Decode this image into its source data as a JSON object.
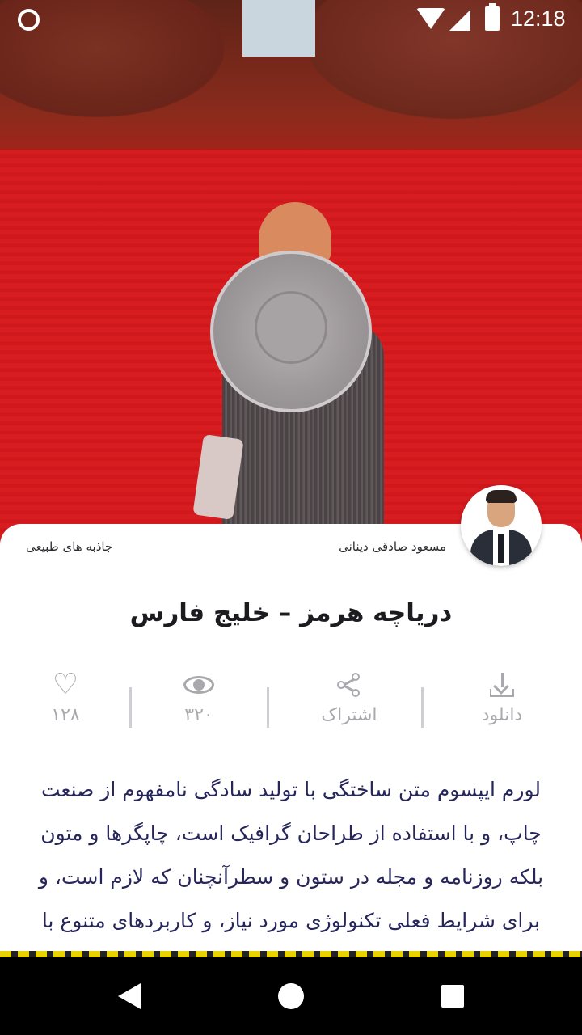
{
  "status_bar": {
    "time": "12:18"
  },
  "post": {
    "author": "مسعود صادقی دینانی",
    "category": "جاذبه های طبیعی",
    "title": "دریاچه هرمز – خلیج فارس",
    "actions": {
      "download_label": "دانلود",
      "share_label": "اشتراک",
      "views_count": "۳۲۰",
      "likes_count": "۱۲۸"
    },
    "body": "لورم ایپسوم متن ساختگی با تولید سادگی نامفهوم از صنعت چاپ، و با استفاده از طراحان گرافیک است، چاپگرها و متون بلکه روزنامه و مجله در ستون و سطرآنچنان که لازم است، و برای شرایط فعلی تکنولوژی مورد نیاز، و کاربردهای متنوع با هدف"
  },
  "icons": {
    "download": "download-icon",
    "share": "share-icon",
    "views": "eye-icon",
    "likes": "heart-icon"
  }
}
